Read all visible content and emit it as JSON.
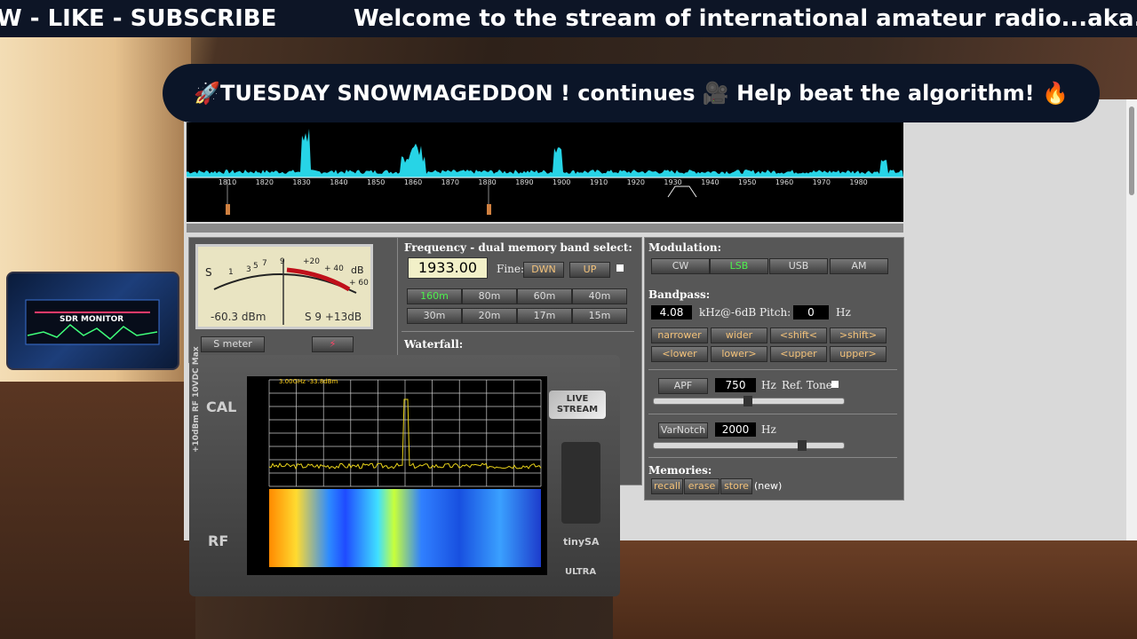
{
  "ticker": {
    "left_text": "W - LIKE - SUBSCRIBE",
    "right_text": "Welcome to the stream of international amateur radio...aka...H"
  },
  "banner": {
    "text": "🚀TUESDAY SNOWMAGEDDON ! continues 🎥 Help beat the algorithm! 🔥"
  },
  "spectrum": {
    "freq_labels": [
      "1810",
      "1820",
      "1830",
      "1840",
      "1850",
      "1860",
      "1870",
      "1880",
      "1890",
      "1900",
      "1910",
      "1920",
      "1930",
      "1940",
      "1950",
      "1960",
      "1970",
      "1980"
    ],
    "color": "#27d4e6"
  },
  "smeter": {
    "scale": [
      "S",
      "1",
      "3",
      "5",
      "7",
      "9",
      "+20",
      "+ 40",
      "dB",
      "+ 60"
    ],
    "dbm": "-60.3 dBm",
    "s_reading": "S 9 +13dB",
    "button_label": "S meter",
    "button2_icon": "lightning-icon"
  },
  "frequency": {
    "title": "Frequency - dual memory band select:",
    "value": "1933.00",
    "fine_label": "Fine:",
    "down_label": "DWN",
    "up_label": "UP",
    "bands": [
      "160m",
      "80m",
      "60m",
      "40m",
      "30m",
      "20m",
      "17m",
      "15m"
    ],
    "selected_band": "160m",
    "waterfall_title": "Waterfall:"
  },
  "modulation": {
    "title": "Modulation:",
    "modes": [
      "CW",
      "LSB",
      "USB",
      "AM"
    ],
    "selected_mode": "LSB",
    "bandpass_title": "Bandpass:",
    "bandpass_value": "4.08",
    "bandpass_unit": "kHz@-6dB",
    "pitch_label": "Pitch:",
    "pitch_value": "0",
    "pitch_unit": "Hz",
    "bp_buttons": [
      "narrower",
      "wider",
      "<shift<",
      ">shift>",
      "<lower",
      "lower>",
      "<upper",
      "upper>"
    ],
    "apf_label": "APF",
    "apf_value": "750",
    "apf_unit": "Hz",
    "ref_tone_label": "Ref. Tone",
    "apf_slider_level": 0.5,
    "varnotch_label": "VarNotch",
    "varnotch_value": "2000",
    "varnotch_unit": "Hz",
    "varnotch_slider_level": 0.8,
    "memories_title": "Memories:",
    "mem_buttons": [
      "recall",
      "erase",
      "store"
    ],
    "mem_status": "(new)"
  },
  "sdr_badge": {
    "title": "SDR MONITOR"
  },
  "tinysa": {
    "cal_label": "CAL",
    "rf_label": "RF",
    "side_text": "+10dBm RF  10VDC Max",
    "brand": "tinySA",
    "model": "ULTRA",
    "screen_header": "3.00GHz  -33.8dBm",
    "live_line1": "LIVE",
    "live_line2": "STREAM"
  }
}
